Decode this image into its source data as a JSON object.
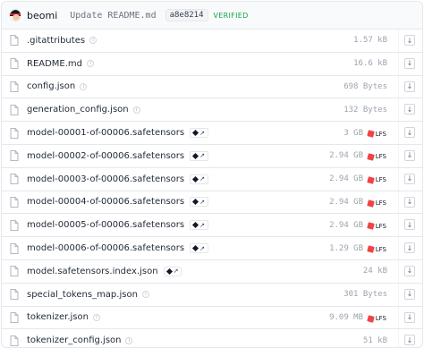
{
  "commit": {
    "author": "beomi",
    "message": "Update README.md",
    "hash": "a8e8214",
    "verified": "VERIFIED"
  },
  "files": [
    {
      "name": ".gitattributes",
      "size": "1.57 kB",
      "lfs": false,
      "tag": false
    },
    {
      "name": "README.md",
      "size": "16.6 kB",
      "lfs": false,
      "tag": false
    },
    {
      "name": "config.json",
      "size": "698 Bytes",
      "lfs": false,
      "tag": false
    },
    {
      "name": "generation_config.json",
      "size": "132 Bytes",
      "lfs": false,
      "tag": false
    },
    {
      "name": "model-00001-of-00006.safetensors",
      "size": "3 GB",
      "lfs": true,
      "tag": true
    },
    {
      "name": "model-00002-of-00006.safetensors",
      "size": "2.94 GB",
      "lfs": true,
      "tag": true
    },
    {
      "name": "model-00003-of-00006.safetensors",
      "size": "2.94 GB",
      "lfs": true,
      "tag": true
    },
    {
      "name": "model-00004-of-00006.safetensors",
      "size": "2.94 GB",
      "lfs": true,
      "tag": true
    },
    {
      "name": "model-00005-of-00006.safetensors",
      "size": "2.94 GB",
      "lfs": true,
      "tag": true
    },
    {
      "name": "model-00006-of-00006.safetensors",
      "size": "1.29 GB",
      "lfs": true,
      "tag": true
    },
    {
      "name": "model.safetensors.index.json",
      "size": "24 kB",
      "lfs": false,
      "tag": true
    },
    {
      "name": "special_tokens_map.json",
      "size": "301 Bytes",
      "lfs": false,
      "tag": false
    },
    {
      "name": "tokenizer.json",
      "size": "9.09 MB",
      "lfs": true,
      "tag": false
    },
    {
      "name": "tokenizer_config.json",
      "size": "51 kB",
      "lfs": false,
      "tag": false
    }
  ],
  "lfs_label": "LFS",
  "icons": {
    "file": "file-icon",
    "info": "info-icon",
    "download": "download-icon",
    "lfs": "lfs-icon",
    "tag": "safetensors-tag-icon"
  },
  "colors": {
    "verified": "#16a34a",
    "lfs": "#ef4444",
    "border": "#e5e7eb"
  }
}
